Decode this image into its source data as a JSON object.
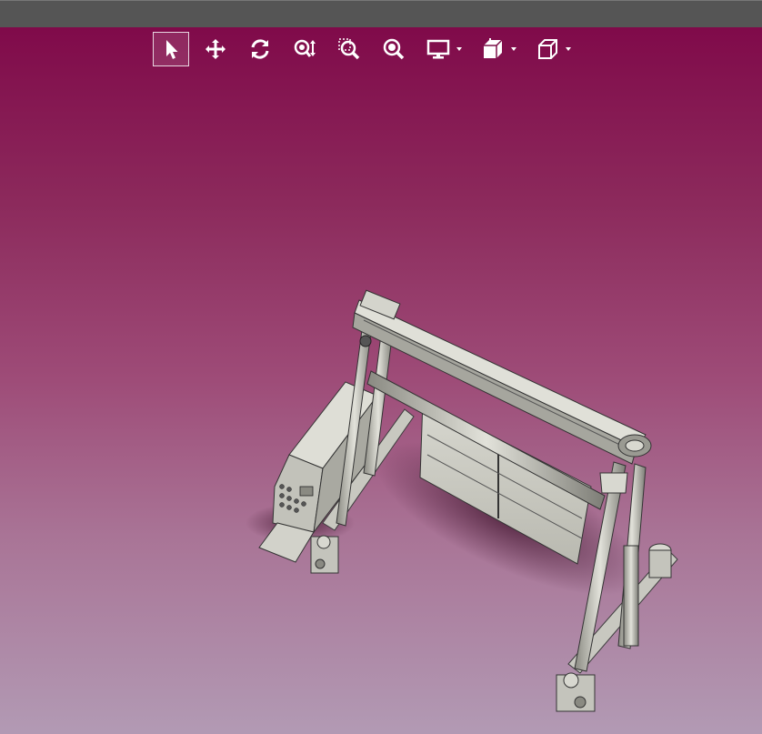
{
  "app": {
    "window_title": ""
  },
  "toolbar": {
    "tools": [
      {
        "icon": "select-arrow-icon",
        "active": true
      },
      {
        "icon": "pan-icon",
        "active": false
      },
      {
        "icon": "rotate-icon",
        "active": false
      },
      {
        "icon": "zoom-in-out-icon",
        "active": false
      },
      {
        "icon": "zoom-area-icon",
        "active": false
      },
      {
        "icon": "zoom-fit-icon",
        "active": false
      },
      {
        "icon": "display-style-icon",
        "active": false,
        "dropdown": true
      },
      {
        "icon": "section-view-icon",
        "active": false,
        "dropdown": true
      },
      {
        "icon": "view-orientation-cube-icon",
        "active": false,
        "dropdown": true
      }
    ]
  },
  "colors": {
    "viewport_top": "#800a4a",
    "viewport_bottom": "#b29ab4",
    "title_bar": "#555555",
    "toolbar_icon": "#ffffff",
    "model_steel": "#cfcfc6"
  },
  "model": {
    "description_icon": "gantry-crane-3d-model-icon"
  }
}
